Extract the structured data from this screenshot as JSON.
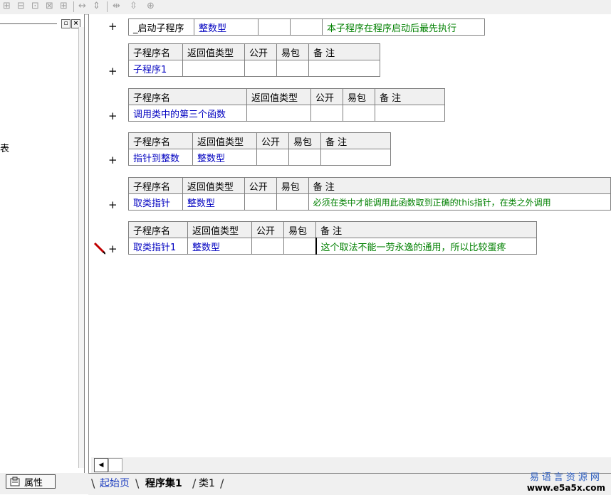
{
  "toolbar": {
    "icons": [
      "align-left-icon",
      "align-top-icon",
      "align-center-icon",
      "align-right-icon",
      "same-width-icon",
      "same-height-icon",
      "horizontal-space-icon",
      "vertical-space-icon",
      "center-icon"
    ]
  },
  "left_panel": {
    "truncated_text": "表",
    "prop_tab_label": "属性"
  },
  "editor": {
    "startup_row": {
      "name": "_启动子程序",
      "return_type": "整数型",
      "public": "",
      "easy_pack": "",
      "remark": "本子程序在程序启动后最先执行"
    },
    "headers": {
      "name": "子程序名",
      "return_type": "返回值类型",
      "public": "公开",
      "easy_pack": "易包",
      "remark": "备 注"
    },
    "subs": [
      {
        "name": "子程序1",
        "return_type": "",
        "public": "",
        "easy_pack": "",
        "remark": ""
      },
      {
        "name": "调用类中的第三个函数",
        "return_type": "",
        "public": "",
        "easy_pack": "",
        "remark": ""
      },
      {
        "name": "指针到整数",
        "return_type": "整数型",
        "public": "",
        "easy_pack": "",
        "remark": ""
      },
      {
        "name": "取类指针",
        "return_type": "整数型",
        "public": "",
        "easy_pack": "",
        "remark": "必须在类中才能调用此函数取到正确的this指针，在类之外调用"
      },
      {
        "name": "取类指针1",
        "return_type": "整数型",
        "public": "",
        "easy_pack": "",
        "remark": "这个取法不能一劳永逸的通用，所以比较蛋疼"
      }
    ],
    "plus": "+"
  },
  "tabs": {
    "start": "起始页",
    "program_set": "程序集1",
    "class": "类1"
  },
  "watermark": {
    "line1": "易语言资源网",
    "line2": "www.e5a5x.com"
  },
  "colors": {
    "blue_text": "#0000c0",
    "green_text": "#008000",
    "header_bg": "#f0f0f0"
  }
}
